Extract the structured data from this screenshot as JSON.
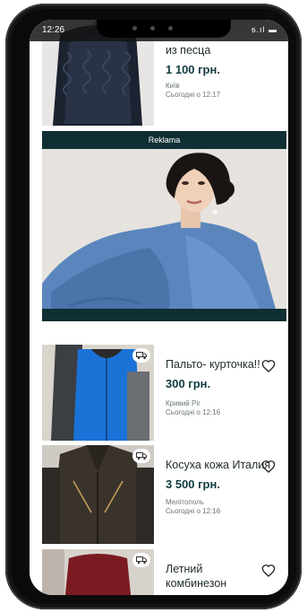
{
  "status": {
    "time": "12:26",
    "right": "ᵴ.ıl ▬"
  },
  "listings": [
    {
      "title": "из песца",
      "price": "1 100 грн.",
      "city": "Київ",
      "time": "Сьогодні о 12:17",
      "thumb": "fur-vest"
    },
    {
      "title": "Пальто- курточка!!",
      "price": "300 грн.",
      "city": "Кривий Ріг",
      "time": "Сьогодні о 12:16",
      "thumb": "blue-coat"
    },
    {
      "title": "Косуха кожа Италия",
      "price": "3 500 грн.",
      "city": "Мелітополь",
      "time": "Сьогодні о 12:16",
      "thumb": "leather-jacket"
    },
    {
      "title": "Летний комбинезон",
      "price": "",
      "city": "",
      "time": "",
      "thumb": "summer-jumpsuit"
    }
  ],
  "ad": {
    "label": "Reklama"
  },
  "colors": {
    "accent": "#123c41",
    "ad_bar": "#0e2f33",
    "frame": "#0b0b0b"
  }
}
